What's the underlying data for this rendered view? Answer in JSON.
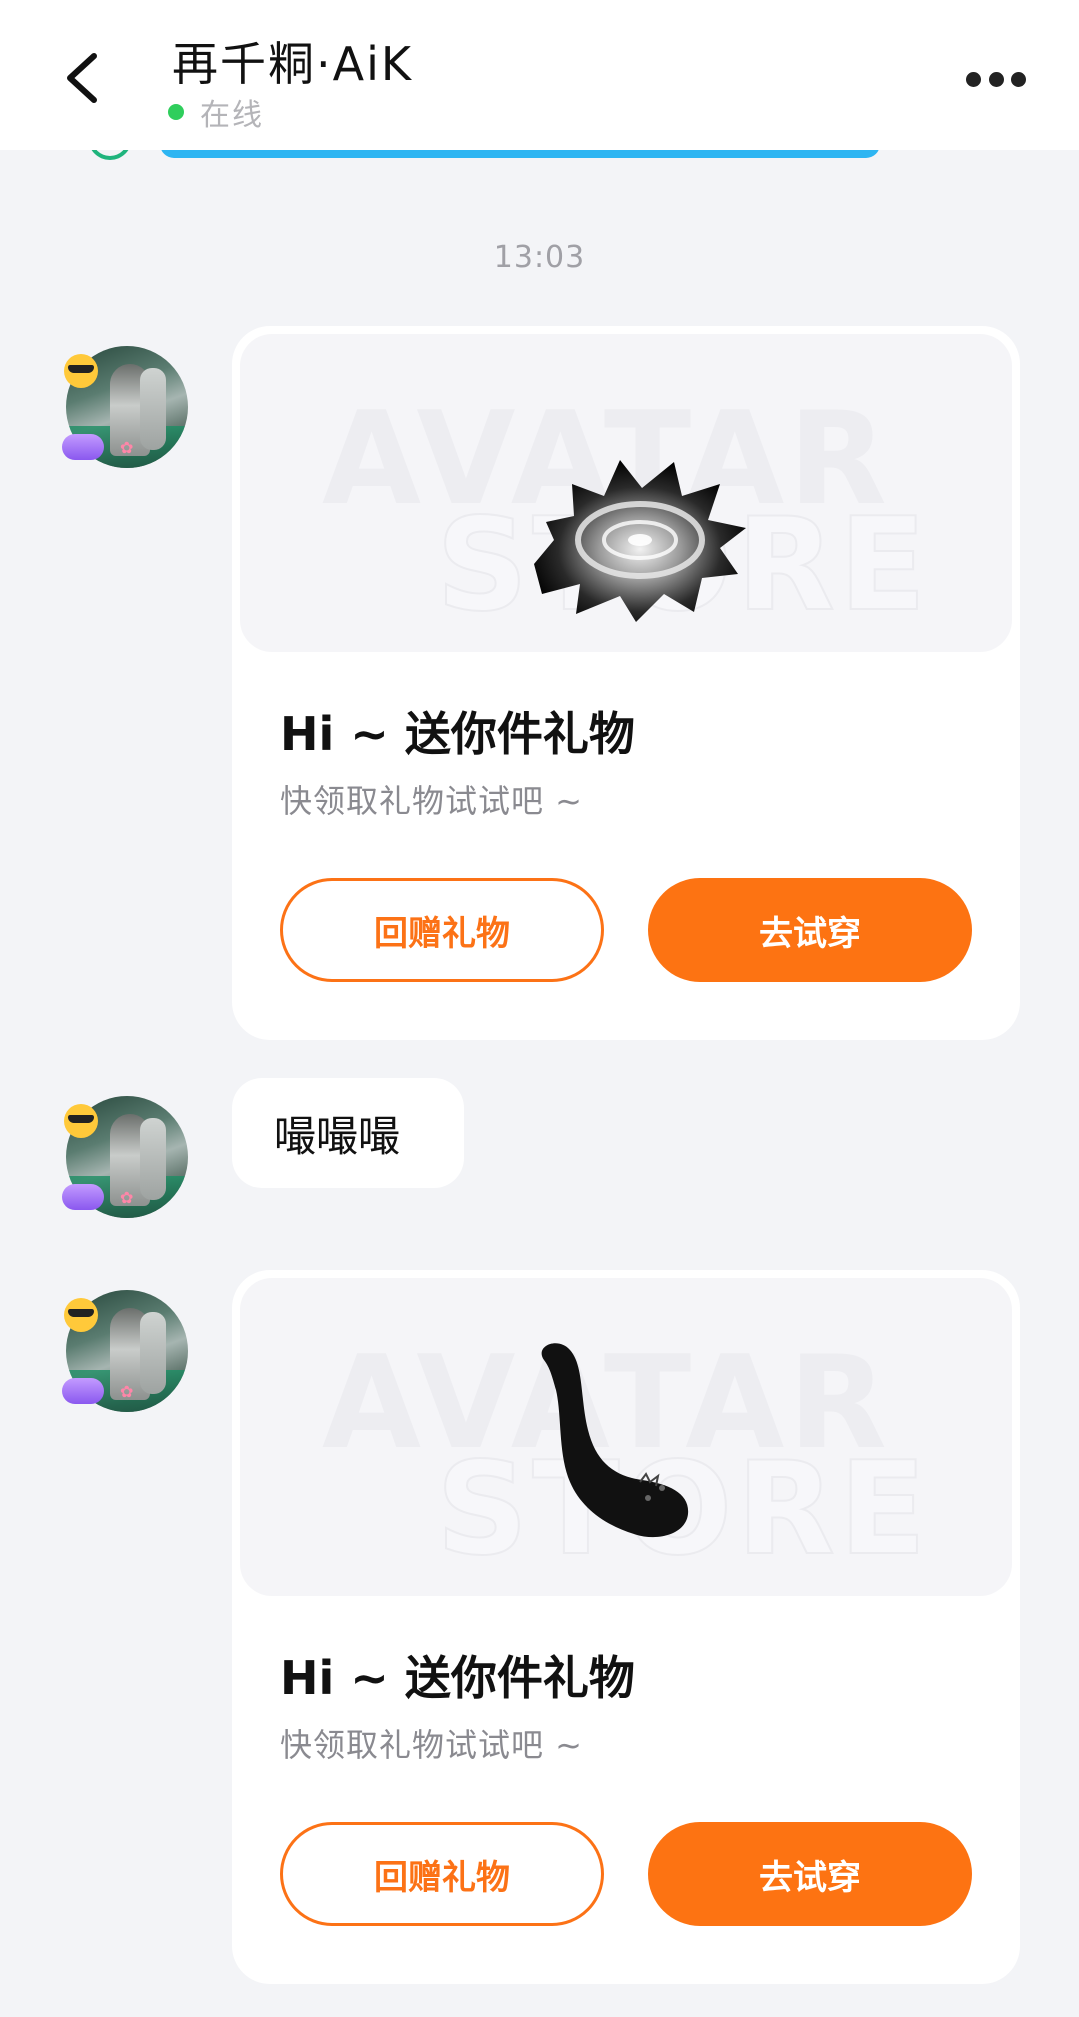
{
  "header": {
    "title": "再千粡·AiK",
    "status": "在线"
  },
  "timestamp": "13:03",
  "messages": [
    {
      "type": "gift",
      "item_icon": "smoke-ring-effect",
      "watermark_line1": "AVATAR",
      "watermark_line2": "STORE",
      "title": "Hi ~ 送你件礼物",
      "subtitle": "快领取礼物试试吧 ~",
      "secondary_button": "回赠礼物",
      "primary_button": "去试穿"
    },
    {
      "type": "text",
      "text": "嘬嘬嘬"
    },
    {
      "type": "gift",
      "item_icon": "black-cat-tail",
      "watermark_line1": "AVATAR",
      "watermark_line2": "STORE",
      "title": "Hi ~ 送你件礼物",
      "subtitle": "快领取礼物试试吧 ~",
      "secondary_button": "回赠礼物",
      "primary_button": "去试穿"
    }
  ],
  "colors": {
    "accent": "#fd7312",
    "online": "#2fce5c",
    "background": "#f3f4f7"
  }
}
